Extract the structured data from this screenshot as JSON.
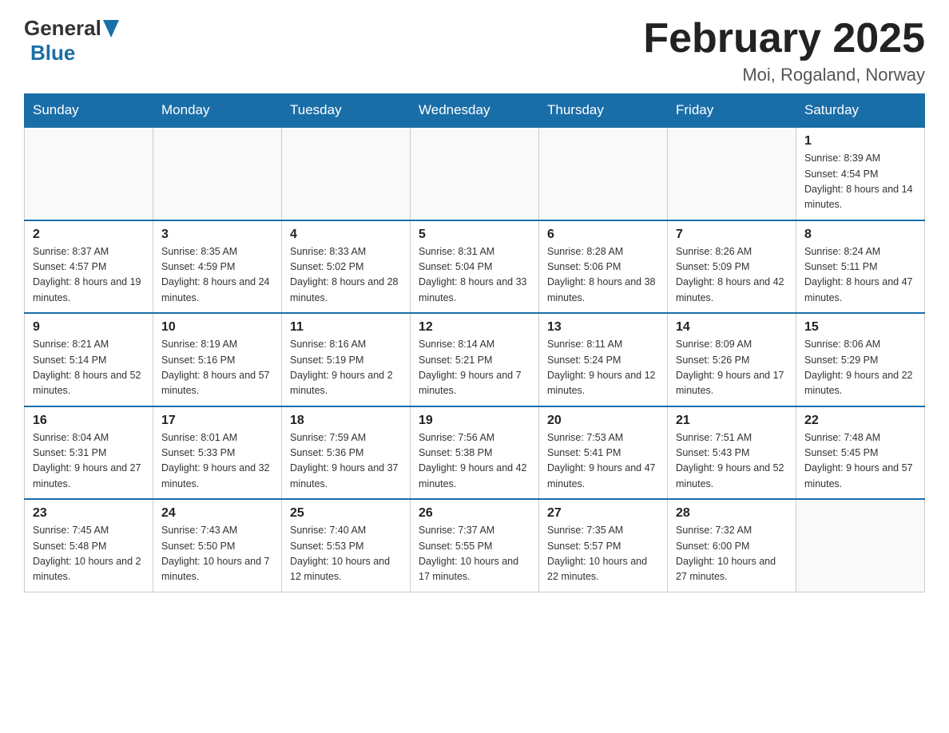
{
  "header": {
    "title": "February 2025",
    "location": "Moi, Rogaland, Norway",
    "logo_general": "General",
    "logo_blue": "Blue"
  },
  "days_of_week": [
    "Sunday",
    "Monday",
    "Tuesday",
    "Wednesday",
    "Thursday",
    "Friday",
    "Saturday"
  ],
  "weeks": [
    {
      "days": [
        {
          "number": "",
          "info": ""
        },
        {
          "number": "",
          "info": ""
        },
        {
          "number": "",
          "info": ""
        },
        {
          "number": "",
          "info": ""
        },
        {
          "number": "",
          "info": ""
        },
        {
          "number": "",
          "info": ""
        },
        {
          "number": "1",
          "info": "Sunrise: 8:39 AM\nSunset: 4:54 PM\nDaylight: 8 hours\nand 14 minutes."
        }
      ]
    },
    {
      "days": [
        {
          "number": "2",
          "info": "Sunrise: 8:37 AM\nSunset: 4:57 PM\nDaylight: 8 hours\nand 19 minutes."
        },
        {
          "number": "3",
          "info": "Sunrise: 8:35 AM\nSunset: 4:59 PM\nDaylight: 8 hours\nand 24 minutes."
        },
        {
          "number": "4",
          "info": "Sunrise: 8:33 AM\nSunset: 5:02 PM\nDaylight: 8 hours\nand 28 minutes."
        },
        {
          "number": "5",
          "info": "Sunrise: 8:31 AM\nSunset: 5:04 PM\nDaylight: 8 hours\nand 33 minutes."
        },
        {
          "number": "6",
          "info": "Sunrise: 8:28 AM\nSunset: 5:06 PM\nDaylight: 8 hours\nand 38 minutes."
        },
        {
          "number": "7",
          "info": "Sunrise: 8:26 AM\nSunset: 5:09 PM\nDaylight: 8 hours\nand 42 minutes."
        },
        {
          "number": "8",
          "info": "Sunrise: 8:24 AM\nSunset: 5:11 PM\nDaylight: 8 hours\nand 47 minutes."
        }
      ]
    },
    {
      "days": [
        {
          "number": "9",
          "info": "Sunrise: 8:21 AM\nSunset: 5:14 PM\nDaylight: 8 hours\nand 52 minutes."
        },
        {
          "number": "10",
          "info": "Sunrise: 8:19 AM\nSunset: 5:16 PM\nDaylight: 8 hours\nand 57 minutes."
        },
        {
          "number": "11",
          "info": "Sunrise: 8:16 AM\nSunset: 5:19 PM\nDaylight: 9 hours\nand 2 minutes."
        },
        {
          "number": "12",
          "info": "Sunrise: 8:14 AM\nSunset: 5:21 PM\nDaylight: 9 hours\nand 7 minutes."
        },
        {
          "number": "13",
          "info": "Sunrise: 8:11 AM\nSunset: 5:24 PM\nDaylight: 9 hours\nand 12 minutes."
        },
        {
          "number": "14",
          "info": "Sunrise: 8:09 AM\nSunset: 5:26 PM\nDaylight: 9 hours\nand 17 minutes."
        },
        {
          "number": "15",
          "info": "Sunrise: 8:06 AM\nSunset: 5:29 PM\nDaylight: 9 hours\nand 22 minutes."
        }
      ]
    },
    {
      "days": [
        {
          "number": "16",
          "info": "Sunrise: 8:04 AM\nSunset: 5:31 PM\nDaylight: 9 hours\nand 27 minutes."
        },
        {
          "number": "17",
          "info": "Sunrise: 8:01 AM\nSunset: 5:33 PM\nDaylight: 9 hours\nand 32 minutes."
        },
        {
          "number": "18",
          "info": "Sunrise: 7:59 AM\nSunset: 5:36 PM\nDaylight: 9 hours\nand 37 minutes."
        },
        {
          "number": "19",
          "info": "Sunrise: 7:56 AM\nSunset: 5:38 PM\nDaylight: 9 hours\nand 42 minutes."
        },
        {
          "number": "20",
          "info": "Sunrise: 7:53 AM\nSunset: 5:41 PM\nDaylight: 9 hours\nand 47 minutes."
        },
        {
          "number": "21",
          "info": "Sunrise: 7:51 AM\nSunset: 5:43 PM\nDaylight: 9 hours\nand 52 minutes."
        },
        {
          "number": "22",
          "info": "Sunrise: 7:48 AM\nSunset: 5:45 PM\nDaylight: 9 hours\nand 57 minutes."
        }
      ]
    },
    {
      "days": [
        {
          "number": "23",
          "info": "Sunrise: 7:45 AM\nSunset: 5:48 PM\nDaylight: 10 hours\nand 2 minutes."
        },
        {
          "number": "24",
          "info": "Sunrise: 7:43 AM\nSunset: 5:50 PM\nDaylight: 10 hours\nand 7 minutes."
        },
        {
          "number": "25",
          "info": "Sunrise: 7:40 AM\nSunset: 5:53 PM\nDaylight: 10 hours\nand 12 minutes."
        },
        {
          "number": "26",
          "info": "Sunrise: 7:37 AM\nSunset: 5:55 PM\nDaylight: 10 hours\nand 17 minutes."
        },
        {
          "number": "27",
          "info": "Sunrise: 7:35 AM\nSunset: 5:57 PM\nDaylight: 10 hours\nand 22 minutes."
        },
        {
          "number": "28",
          "info": "Sunrise: 7:32 AM\nSunset: 6:00 PM\nDaylight: 10 hours\nand 27 minutes."
        },
        {
          "number": "",
          "info": ""
        }
      ]
    }
  ]
}
